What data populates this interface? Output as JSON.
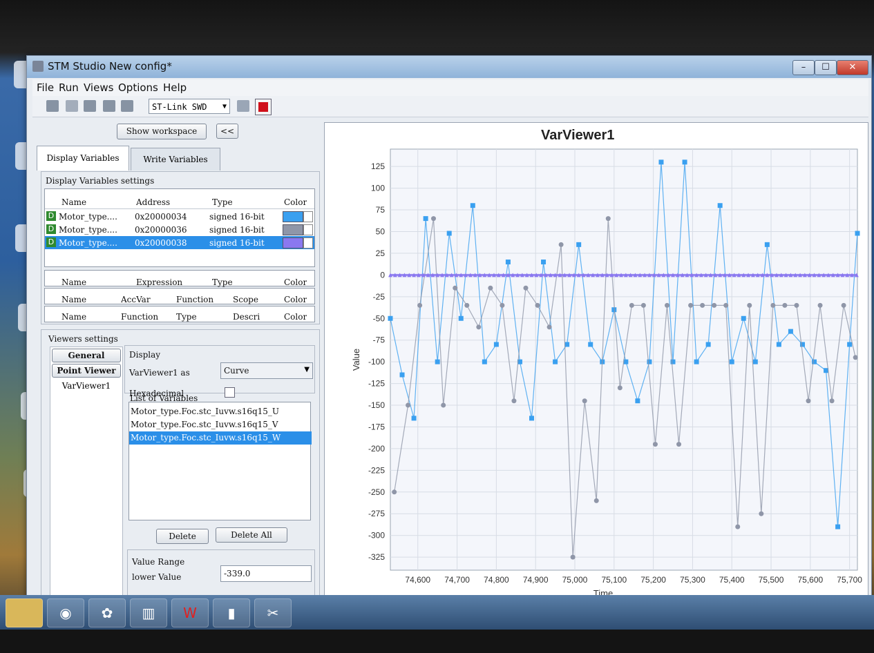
{
  "window": {
    "title": "STM Studio New config*",
    "minimize": "–",
    "maximize": "☐",
    "close": "✕"
  },
  "menu": [
    "File",
    "Run",
    "Views",
    "Options",
    "Help"
  ],
  "toolbar": {
    "connection": "ST-Link SWD"
  },
  "left": {
    "show_workspace": "Show workspace",
    "collapse": "<<",
    "tabs": {
      "display": "Display Variables",
      "write": "Write Variables"
    },
    "settings_title": "Display Variables settings",
    "var_headers": {
      "name": "Name",
      "address": "Address",
      "type": "Type",
      "color": "Color"
    },
    "variables": [
      {
        "badge": "D",
        "name": "Motor_type....",
        "address": "0x20000034",
        "type": "signed 16-bit",
        "color": "#3aa0f0"
      },
      {
        "badge": "D",
        "name": "Motor_type....",
        "address": "0x20000036",
        "type": "signed 16-bit",
        "color": "#8f96a8"
      },
      {
        "badge": "D",
        "name": "Motor_type....",
        "address": "0x20000038",
        "type": "signed 16-bit",
        "color": "#8a78f0"
      }
    ],
    "expr_headers": {
      "name": "Name",
      "expression": "Expression",
      "type": "Type",
      "color": "Color"
    },
    "acc_headers": {
      "name": "Name",
      "accvar": "AccVar",
      "function": "Function",
      "scope": "Scope",
      "color": "Color"
    },
    "fn_headers": {
      "name": "Name",
      "function": "Function",
      "type": "Type",
      "descri": "Descri",
      "color": "Color"
    },
    "viewers_title": "Viewers settings",
    "viewer_tabs": [
      "General",
      "Point Viewer",
      "VarViewer1"
    ],
    "display_group": "Display",
    "viewer_as_label": "VarViewer1 as",
    "viewer_as_value": "Curve",
    "hex_label": "Hexadecimal",
    "list_title": "List of Variables",
    "list_items": [
      "Motor_type.Foc.stc_Iuvw.s16q15_U",
      "Motor_type.Foc.stc_Iuvw.s16q15_V",
      "Motor_type.Foc.stc_Iuvw.s16q15_W"
    ],
    "delete": "Delete",
    "delete_all": "Delete All",
    "range_group": "Value Range",
    "lower_label": "lower Value",
    "lower_value": "-339.0"
  },
  "chart_data": {
    "type": "line",
    "title": "VarViewer1",
    "xlabel": "Time",
    "ylabel": "Value",
    "xlim": [
      74530,
      75720
    ],
    "ylim": [
      -340,
      145
    ],
    "x_ticks": [
      74600,
      74700,
      74800,
      74900,
      75000,
      75100,
      75200,
      75300,
      75400,
      75500,
      75600,
      75700
    ],
    "x_tick_labels": [
      "74,600",
      "74,700",
      "74,800",
      "74,900",
      "75,000",
      "75,100",
      "75,200",
      "75,300",
      "75,400",
      "75,500",
      "75,600",
      "75,700"
    ],
    "y_ticks": [
      125,
      100,
      75,
      50,
      25,
      0,
      -25,
      -50,
      -75,
      -100,
      -125,
      -150,
      -175,
      -200,
      -225,
      -250,
      -275,
      -300,
      -325
    ],
    "grid": true,
    "series": [
      {
        "color": "#3aa0f0",
        "marker": "square",
        "x": [
          74530,
          74560,
          74590,
          74620,
          74650,
          74680,
          74710,
          74740,
          74770,
          74800,
          74830,
          74860,
          74890,
          74920,
          74950,
          74980,
          75010,
          75040,
          75070,
          75100,
          75130,
          75160,
          75190,
          75220,
          75250,
          75280,
          75310,
          75340,
          75370,
          75400,
          75430,
          75460,
          75490,
          75520,
          75550,
          75580,
          75610,
          75640,
          75670,
          75700,
          75720
        ],
        "y": [
          -50,
          -115,
          -165,
          65,
          -100,
          48,
          -50,
          80,
          -100,
          -80,
          15,
          -100,
          -165,
          15,
          -100,
          -80,
          35,
          -80,
          -100,
          -40,
          -100,
          -145,
          -100,
          130,
          -100,
          130,
          -100,
          -80,
          80,
          -100,
          -50,
          -100,
          35,
          -80,
          -65,
          -80,
          -100,
          -110,
          -290,
          -80,
          48
        ]
      },
      {
        "color": "#8f96a8",
        "marker": "circle",
        "x": [
          74540,
          74575,
          74605,
          74640,
          74665,
          74695,
          74725,
          74755,
          74785,
          74815,
          74845,
          74875,
          74905,
          74935,
          74965,
          74995,
          75025,
          75055,
          75085,
          75115,
          75145,
          75175,
          75205,
          75235,
          75265,
          75295,
          75325,
          75355,
          75385,
          75415,
          75445,
          75475,
          75505,
          75535,
          75565,
          75595,
          75625,
          75655,
          75685,
          75715
        ],
        "y": [
          -250,
          -150,
          -35,
          65,
          -150,
          -15,
          -35,
          -60,
          -15,
          -35,
          -145,
          -15,
          -35,
          -60,
          35,
          -325,
          -145,
          -260,
          65,
          -130,
          -35,
          -35,
          -195,
          -35,
          -195,
          -35,
          -35,
          -35,
          -35,
          -290,
          -35,
          -275,
          -35,
          -35,
          -35,
          -145,
          -35,
          -145,
          -35,
          -95
        ]
      },
      {
        "color": "#8a78f0",
        "marker": "triangle",
        "x": [
          74530,
          75720
        ],
        "y": [
          0,
          0
        ]
      }
    ]
  }
}
